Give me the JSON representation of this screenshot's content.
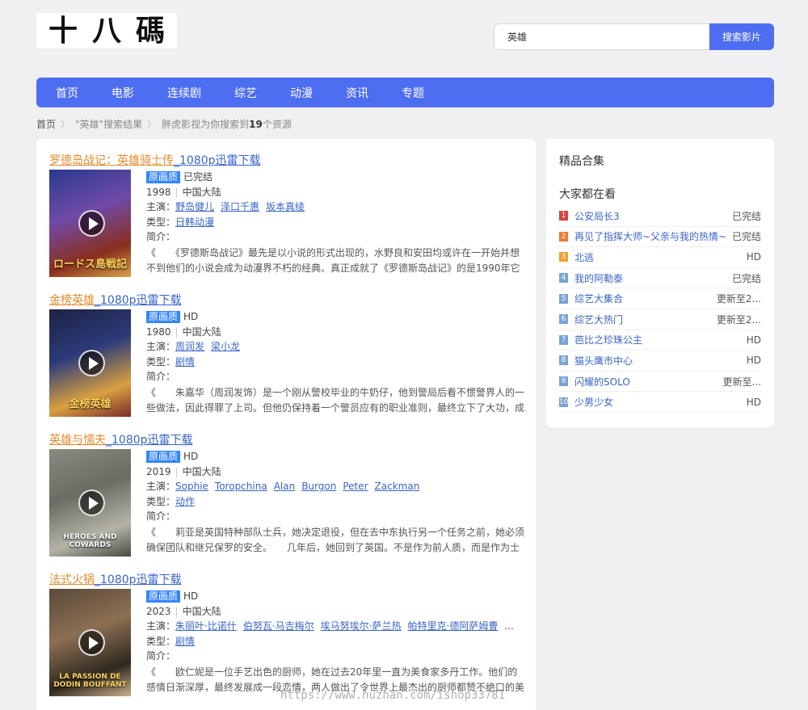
{
  "logo_text": "十八碼",
  "search": {
    "value": "英雄",
    "button": "搜索影片"
  },
  "nav": [
    "首页",
    "电影",
    "连续剧",
    "综艺",
    "动漫",
    "资讯",
    "专题"
  ],
  "breadcrumb": {
    "home": "首页",
    "query": "\"英雄\"搜索结果",
    "prefix": "胖虎影视为你搜索到",
    "count": "19",
    "suffix": "个资源"
  },
  "results": [
    {
      "name": "罗德岛战记：英雄骑士传",
      "dl": "_1080p迅雷下载",
      "badge": "原画质",
      "status": "已完结",
      "year": "1998",
      "region": "中国大陆",
      "actors_label": "主演：",
      "actors": [
        "野岛健儿",
        "泽口千惠",
        "坂本真绫"
      ],
      "type_label": "类型：",
      "types": [
        "日韩动漫"
      ],
      "intro_label": "简介：",
      "desc": "《　　《罗德斯岛战记》最先是以小说的形式出现的，水野良和安田均或许在一开始并想不到他们的小说会成为动漫界不朽的经典。真正成就了《罗德斯岛战记》的是1990年它首次",
      "poster_text": "ロードス島戦記",
      "poster_colors": [
        "#2a3a8c",
        "#6f4aa8",
        "#d7a247",
        "#8a2f1e"
      ]
    },
    {
      "name": "金榜英雄",
      "dl": "_1080p迅雷下载",
      "badge": "原画质",
      "status": "HD",
      "year": "1980",
      "region": "中国大陆",
      "actors_label": "主演：",
      "actors": [
        "周润发",
        "梁小龙"
      ],
      "type_label": "类型：",
      "types": [
        "剧情"
      ],
      "intro_label": "简介：",
      "desc": "《　　朱嘉华（周润发饰）是一个刚从警校毕业的牛奶仔，他到警局后看不惯警界人的一些做法，因此得罪了上司。但他仍保持着一个警员应有的职业准则，最终立下了大功，成为",
      "poster_text": "金榜英雄",
      "poster_colors": [
        "#1d2145",
        "#2c3b7a",
        "#7a2a2a",
        "#d8a040"
      ]
    },
    {
      "name": "英雄与懦夫",
      "dl": "_1080p迅雷下载",
      "badge": "原画质",
      "status": "HD",
      "year": "2019",
      "region": "中国大陆",
      "actors_label": "主演：",
      "actors": [
        "Sophie",
        "Toropchina",
        "Alan",
        "Burgon",
        "Peter",
        "Zackman"
      ],
      "type_label": "类型：",
      "types": [
        "动作"
      ],
      "intro_label": "简介：",
      "desc": "《　　莉亚是英国特种部队士兵，她决定退役，但在去中东执行另一个任务之前，她必须确保团队和继兄保罗的安全。　　几年后，她回到了英国。不是作为前人质，而是作为士兵。",
      "poster_text": "HEROES AND COWARDS",
      "poster_colors": [
        "#8a8a80",
        "#6b6b63",
        "#4a4a44",
        "#b5b3a6"
      ]
    },
    {
      "name": "法式火锅",
      "dl": "_1080p迅雷下载",
      "badge": "原画质",
      "status": "HD",
      "year": "2023",
      "region": "中国大陆",
      "actors_label": "主演：",
      "actors": [
        "朱丽叶·比诺什",
        "伯努瓦·马吉梅尔",
        "埃马努埃尔·萨兰热",
        "帕特里克·德阿萨姆曹"
      ],
      "more": "...",
      "type_label": "类型：",
      "types": [
        "剧情"
      ],
      "intro_label": "简介：",
      "desc": "《　　欧仁妮是一位手艺出色的厨师，她在过去20年里一直为美食家多丹工作。他们的感情日渐深厚，最终发展成一段恋情，两人做出了令世界上最杰出的厨师都赞不绝口的美味佳",
      "poster_text": "LA PASSION DE DODIN BOUFFANT",
      "poster_colors": [
        "#5a4a3a",
        "#8c6f52",
        "#c9b08a",
        "#2e2820"
      ]
    }
  ],
  "sidebar": {
    "title1": "精品合集",
    "title2": "大家都在看",
    "items": [
      {
        "n": "1",
        "title": "公安局长3",
        "status": "已完结",
        "color": "#d9453b"
      },
      {
        "n": "2",
        "title": "再见了指挥大师~父亲与我的热情~",
        "status": "已完结",
        "color": "#ec7b33"
      },
      {
        "n": "3",
        "title": "北逃",
        "status": "HD",
        "color": "#f0a030"
      },
      {
        "n": "4",
        "title": "我的阿勒泰",
        "status": "已完结",
        "color": "#7aa3d6"
      },
      {
        "n": "5",
        "title": "综艺大集合",
        "status": "更新至2...",
        "color": "#7aa3d6"
      },
      {
        "n": "6",
        "title": "综艺大热门",
        "status": "更新至2...",
        "color": "#7aa3d6"
      },
      {
        "n": "7",
        "title": "芭比之珍珠公主",
        "status": "HD",
        "color": "#7aa3d6"
      },
      {
        "n": "8",
        "title": "猫头鹰市中心",
        "status": "HD",
        "color": "#7aa3d6"
      },
      {
        "n": "9",
        "title": "闪耀的SOLO",
        "status": "更新至...",
        "color": "#7aa3d6"
      },
      {
        "n": "10",
        "title": "少男少女",
        "status": "HD",
        "color": "#7aa3d6"
      }
    ]
  },
  "watermark": "https://www.huzhan.com/ishop33781"
}
